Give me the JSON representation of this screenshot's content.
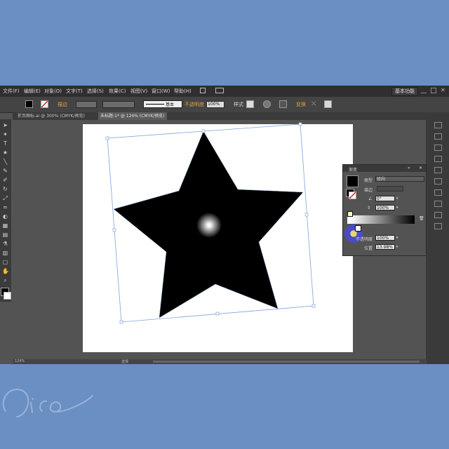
{
  "menu": [
    "文件(F)",
    "编辑(E)",
    "对象(O)",
    "文字(T)",
    "选择(S)",
    "效果(C)",
    "视图(V)",
    "窗口(W)",
    "帮助(H)"
  ],
  "workspace": "基本功能",
  "control": {
    "stroke_label": "描边",
    "basic_label": "基本",
    "opacity_label": "不透明度",
    "opacity_value": "100%",
    "style_label": "样式",
    "transform_label": "变换"
  },
  "tabs": [
    "折页图标.ai @ 300% (CMYK/预览)",
    "未标题-1* @ 124% (CMYK/预览)"
  ],
  "status": {
    "zoom": "124%",
    "tool": "选择"
  },
  "gradient_panel": {
    "title": "渐变",
    "type_label": "类型",
    "type_value": "径向",
    "stroke_label": "描边",
    "angle_value": "0°",
    "ratio_value": "100%",
    "opacity_label": "不透明度",
    "opacity_value": "100%",
    "location_label": "位置",
    "location_value": "13.98%"
  },
  "colors": {
    "background": "#6a8fc3",
    "workspace": "#535353",
    "artboard": "#ffffff",
    "star_fill": "#000000",
    "bbox": "#7fa3d8"
  }
}
